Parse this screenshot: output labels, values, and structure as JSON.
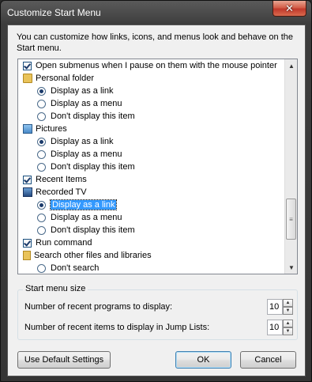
{
  "window": {
    "title": "Customize Start Menu",
    "close_label": "✕"
  },
  "intro_text": "You can customize how links, icons, and menus look and behave on the Start menu.",
  "options": [
    {
      "type": "checkbox",
      "checked": true,
      "label": "Open submenus when I pause on them with the mouse pointer",
      "name": "option-open-submenus"
    },
    {
      "type": "header",
      "icon": "folder-icon",
      "label": "Personal folder",
      "name": "option-personal-folder"
    },
    {
      "type": "radio",
      "checked": true,
      "label": "Display as a link",
      "name": "personal-folder-display-link"
    },
    {
      "type": "radio",
      "checked": false,
      "label": "Display as a menu",
      "name": "personal-folder-display-menu"
    },
    {
      "type": "radio",
      "checked": false,
      "label": "Don't display this item",
      "name": "personal-folder-dont-display"
    },
    {
      "type": "header",
      "icon": "pictures-icon",
      "label": "Pictures",
      "name": "option-pictures"
    },
    {
      "type": "radio",
      "checked": true,
      "label": "Display as a link",
      "name": "pictures-display-link"
    },
    {
      "type": "radio",
      "checked": false,
      "label": "Display as a menu",
      "name": "pictures-display-menu"
    },
    {
      "type": "radio",
      "checked": false,
      "label": "Don't display this item",
      "name": "pictures-dont-display"
    },
    {
      "type": "checkbox",
      "checked": true,
      "label": "Recent Items",
      "name": "option-recent-items"
    },
    {
      "type": "header",
      "icon": "tv-icon",
      "label": "Recorded TV",
      "name": "option-recorded-tv"
    },
    {
      "type": "radio",
      "checked": true,
      "selected": true,
      "label": "Display as a link",
      "name": "recorded-tv-display-link"
    },
    {
      "type": "radio",
      "checked": false,
      "label": "Display as a menu",
      "name": "recorded-tv-display-menu"
    },
    {
      "type": "radio",
      "checked": false,
      "label": "Don't display this item",
      "name": "recorded-tv-dont-display"
    },
    {
      "type": "checkbox",
      "checked": true,
      "label": "Run command",
      "name": "option-run-command"
    },
    {
      "type": "header",
      "icon": "search-icon",
      "label": "Search other files and libraries",
      "name": "option-search-other"
    },
    {
      "type": "radio",
      "checked": false,
      "label": "Don't search",
      "name": "search-dont-search"
    }
  ],
  "start_menu_size": {
    "legend": "Start menu size",
    "recent_programs_label": "Number of recent programs to display:",
    "recent_programs_value": "10",
    "jump_list_label": "Number of recent items to display in Jump Lists:",
    "jump_list_value": "10"
  },
  "buttons": {
    "default_settings": "Use Default Settings",
    "ok": "OK",
    "cancel": "Cancel"
  }
}
